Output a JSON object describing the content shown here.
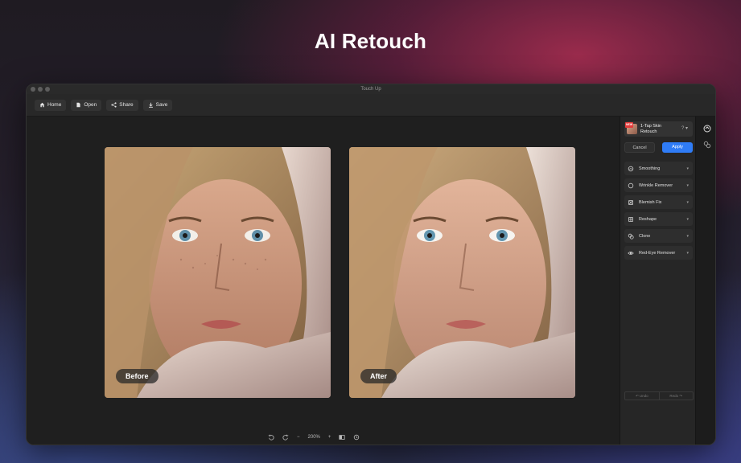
{
  "headline": "AI Retouch",
  "window": {
    "title": "Touch Up"
  },
  "toolbar": {
    "home": "Home",
    "open": "Open",
    "share": "Share",
    "save": "Save"
  },
  "canvas": {
    "before_label": "Before",
    "after_label": "After",
    "zoom": "200%"
  },
  "panel": {
    "feature": {
      "badge": "NEW",
      "line1": "1-Tap Skin",
      "line2": "Retouch",
      "help": "?"
    },
    "cancel": "Cancel",
    "apply": "Apply",
    "tools": [
      {
        "label": "Smoothing",
        "icon": "smoothing-icon"
      },
      {
        "label": "Wrinkle Remover",
        "icon": "wrinkle-icon"
      },
      {
        "label": "Blemish Fix",
        "icon": "blemish-icon"
      },
      {
        "label": "Reshape",
        "icon": "reshape-icon"
      },
      {
        "label": "Clone",
        "icon": "clone-icon"
      },
      {
        "label": "Red-Eye Remover",
        "icon": "eye-icon"
      }
    ],
    "undo": "Undo",
    "redo": "Redo"
  }
}
